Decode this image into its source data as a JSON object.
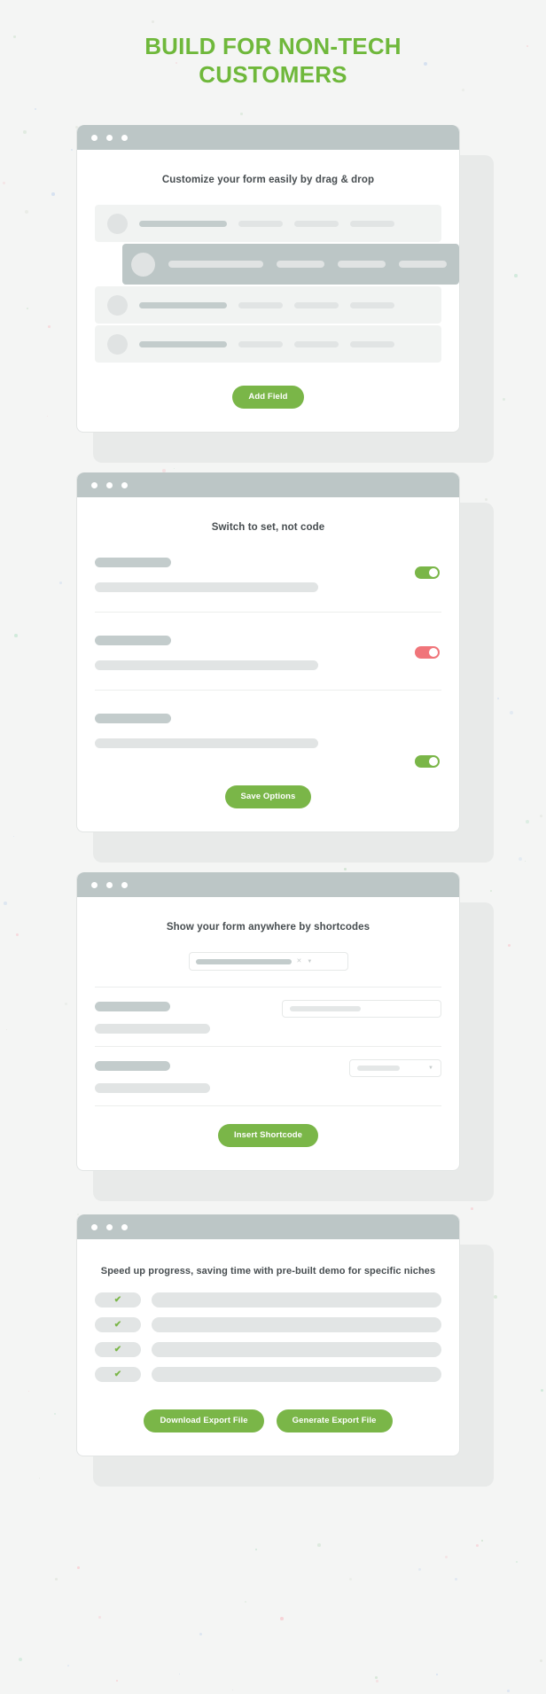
{
  "page": {
    "headline": "BUILD FOR NON-TECH CUSTOMERS",
    "accent_green": "#7ab648",
    "headline_green": "#6fb83b",
    "toggle_off_red": "#f0757a",
    "titlebar_gray": "#bcc6c6",
    "background": "#f4f5f4"
  },
  "cards": [
    {
      "id": "drag-drop",
      "title": "Customize your form easily by drag & drop",
      "button": "Add Field"
    },
    {
      "id": "switch-settings",
      "title": "Switch to set, not code",
      "button": "Save Options",
      "toggles": [
        {
          "state": "on",
          "color": "#7ab648"
        },
        {
          "state": "off",
          "color": "#f0757a"
        },
        {
          "state": "on",
          "color": "#7ab648"
        }
      ]
    },
    {
      "id": "shortcodes",
      "title": "Show your form anywhere by shortcodes",
      "button": "Insert Shortcode",
      "select_clear_icon": "clear-x-icon",
      "select_caret_icon": "chevron-down-icon"
    },
    {
      "id": "prebuilt-demos",
      "title": "Speed up progress, saving time with pre-built demo for specific niches",
      "buttons": [
        "Download Export File",
        "Generate Export File"
      ],
      "check_icon": "check-icon",
      "rows": 4
    }
  ],
  "window_controls": {
    "dots": [
      "close-dot",
      "minimize-dot",
      "maximize-dot"
    ]
  }
}
